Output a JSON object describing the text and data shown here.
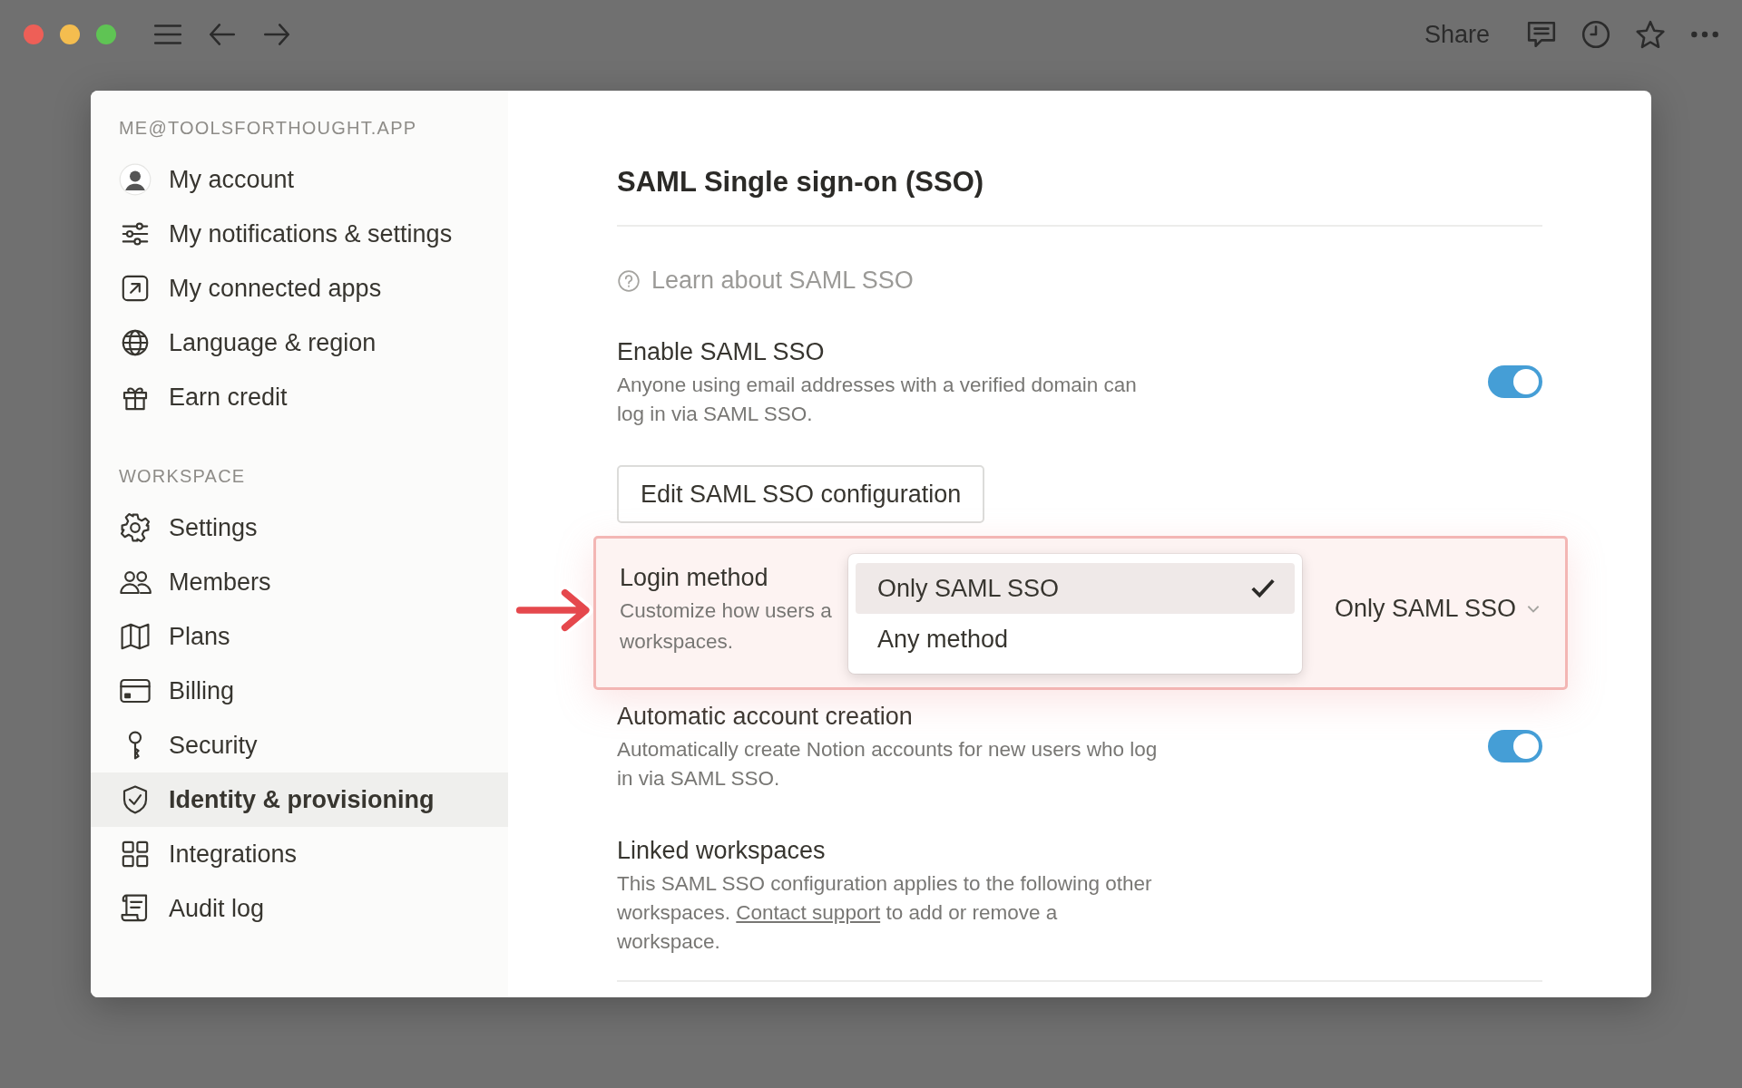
{
  "topbar": {
    "share": "Share"
  },
  "sidebar": {
    "sections": [
      {
        "label": "ME@TOOLSFORTHOUGHT.APP",
        "items": [
          {
            "label": "My account",
            "kind": "avatar",
            "selected": false
          },
          {
            "label": "My notifications & settings",
            "kind": "sliders",
            "selected": false
          },
          {
            "label": "My connected apps",
            "kind": "external",
            "selected": false
          },
          {
            "label": "Language & region",
            "kind": "globe",
            "selected": false
          },
          {
            "label": "Earn credit",
            "kind": "gift",
            "selected": false
          }
        ]
      },
      {
        "label": "WORKSPACE",
        "items": [
          {
            "label": "Settings",
            "kind": "gear",
            "selected": false
          },
          {
            "label": "Members",
            "kind": "people",
            "selected": false
          },
          {
            "label": "Plans",
            "kind": "map",
            "selected": false
          },
          {
            "label": "Billing",
            "kind": "card",
            "selected": false
          },
          {
            "label": "Security",
            "kind": "key",
            "selected": false
          },
          {
            "label": "Identity & provisioning",
            "kind": "shield",
            "selected": true
          },
          {
            "label": "Integrations",
            "kind": "grid",
            "selected": false
          },
          {
            "label": "Audit log",
            "kind": "scroll",
            "selected": false
          }
        ]
      }
    ]
  },
  "content": {
    "title": "SAML Single sign-on (SSO)",
    "help_link": "Learn about SAML SSO",
    "settings": [
      {
        "kind": "toggle",
        "title": "Enable SAML SSO",
        "description": "Anyone using email addresses with a verified domain can log in via SAML SSO.",
        "on": true
      },
      {
        "kind": "button",
        "label": "Edit SAML SSO configuration"
      },
      {
        "kind": "select",
        "title": "Login method",
        "description_lines": [
          "Customize how users a",
          "workspaces."
        ],
        "value": "Only SAML SSO",
        "highlighted": true,
        "open": true,
        "options": [
          {
            "label": "Only SAML SSO",
            "selected": true
          },
          {
            "label": "Any method",
            "selected": false
          }
        ]
      },
      {
        "kind": "toggle",
        "title": "Automatic account creation",
        "description": "Automatically create Notion accounts for new users who log in via SAML SSO.",
        "on": true
      },
      {
        "kind": "text",
        "title": "Linked workspaces",
        "description_before": "This SAML SSO configuration applies to the following other workspaces.",
        "link": "Contact support",
        "description_after": "to add or remove a workspace."
      }
    ]
  }
}
